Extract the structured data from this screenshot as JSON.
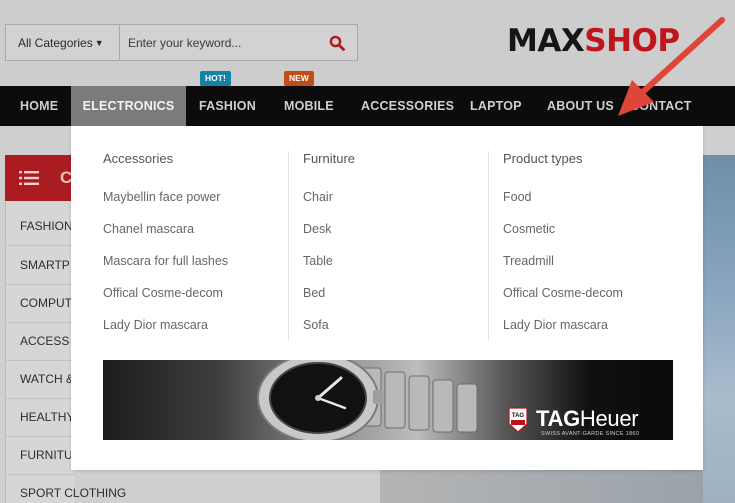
{
  "header": {
    "category_select": "All Categories",
    "search_placeholder": "Enter your keyword...",
    "logo_max": "MAX",
    "logo_shop": "SHOP"
  },
  "nav": {
    "items": [
      {
        "label": "HOME"
      },
      {
        "label": "ELECTRONICS",
        "active": true
      },
      {
        "label": "FASHION",
        "badge": "HOT!"
      },
      {
        "label": "MOBILE",
        "badge": "NEW"
      },
      {
        "label": "ACCESSORIES"
      },
      {
        "label": "LAPTOP"
      },
      {
        "label": "ABOUT US"
      },
      {
        "label": "CONTACT"
      }
    ]
  },
  "sidebar": {
    "header_letter": "C",
    "items": [
      "FASHION",
      "SMARTP",
      "COMPUT",
      "ACCESS",
      "WATCH &",
      "HEALTHY",
      "FURNITU",
      "SPORT CLOTHING"
    ]
  },
  "dropdown": {
    "columns": [
      {
        "title": "Accessories",
        "links": [
          "Maybellin face power",
          "Chanel mascara",
          "Mascara for full lashes",
          "Offical Cosme-decom",
          "Lady Dior mascara"
        ]
      },
      {
        "title": "Furniture",
        "links": [
          "Chair",
          "Desk",
          "Table",
          "Bed",
          "Sofa"
        ]
      },
      {
        "title": "Product types",
        "links": [
          "Food",
          "Cosmetic",
          "Treadmill",
          "Offical Cosme-decom",
          "Lady Dior mascara"
        ]
      }
    ],
    "promo": {
      "brand_prefix": "TAG",
      "brand_suffix": "Heuer",
      "tagline": "SWISS AVANT-GARDE SINCE 1860",
      "logo_mark": "TAG Heuer"
    }
  },
  "colors": {
    "brand_red": "#c0161b",
    "nav_bg": "#0c0c0c",
    "hot_badge": "#1583a8",
    "new_badge": "#c14d18",
    "arrow": "#e0453a"
  }
}
